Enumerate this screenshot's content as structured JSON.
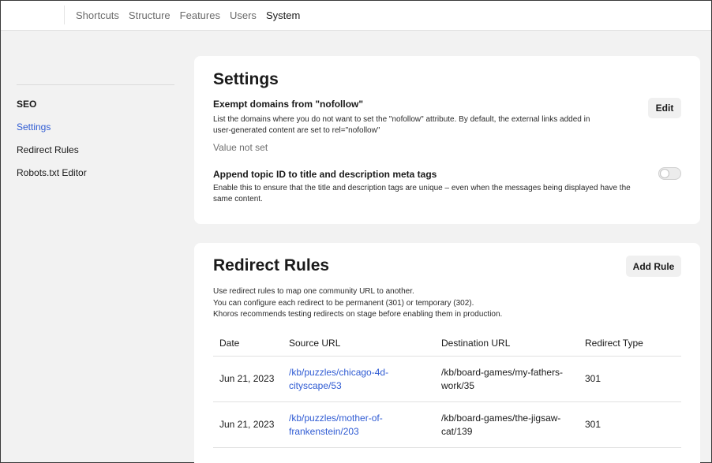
{
  "nav": {
    "items": [
      "Shortcuts",
      "Structure",
      "Features",
      "Users",
      "System"
    ],
    "active_index": 4
  },
  "sidebar": {
    "section": "SEO",
    "items": [
      "Settings",
      "Redirect Rules",
      "Robots.txt Editor"
    ],
    "active_index": 0
  },
  "settings": {
    "title": "Settings",
    "nofollow": {
      "title": "Exempt domains from \"nofollow\"",
      "description": "List the domains where you do not want to set the \"nofollow\" attribute. By default, the external links added in user-generated content are set to rel=\"nofollow\"",
      "value": "Value not set",
      "edit_label": "Edit"
    },
    "topic_id": {
      "title": "Append topic ID to title and description meta tags",
      "description": "Enable this to ensure that the title and description tags are unique – even when the messages being displayed have the same content.",
      "enabled": false
    }
  },
  "redirects": {
    "title": "Redirect Rules",
    "add_label": "Add Rule",
    "intro": [
      "Use redirect rules to map one community URL to another.",
      "You can configure each redirect to be permanent (301) or temporary (302).",
      "Khoros recommends testing redirects on stage before enabling them in production."
    ],
    "columns": [
      "Date",
      "Source URL",
      "Destination URL",
      "Redirect Type"
    ],
    "rows": [
      {
        "date": "Jun 21, 2023",
        "source": [
          "/kb/puzzles/chicago-4d-",
          "cityscape/53"
        ],
        "destination": [
          "/kb/board-games/my-fathers-",
          "work/35"
        ],
        "type": "301"
      },
      {
        "date": "Jun 21, 2023",
        "source": [
          "/kb/puzzles/mother-of-",
          "frankenstein/203"
        ],
        "destination": [
          "/kb/board-games/the-jigsaw-",
          "cat/139"
        ],
        "type": "301"
      }
    ]
  },
  "colors": {
    "accent_link": "#2f5bd3",
    "background": "#f2f2f2",
    "card": "#ffffff"
  }
}
